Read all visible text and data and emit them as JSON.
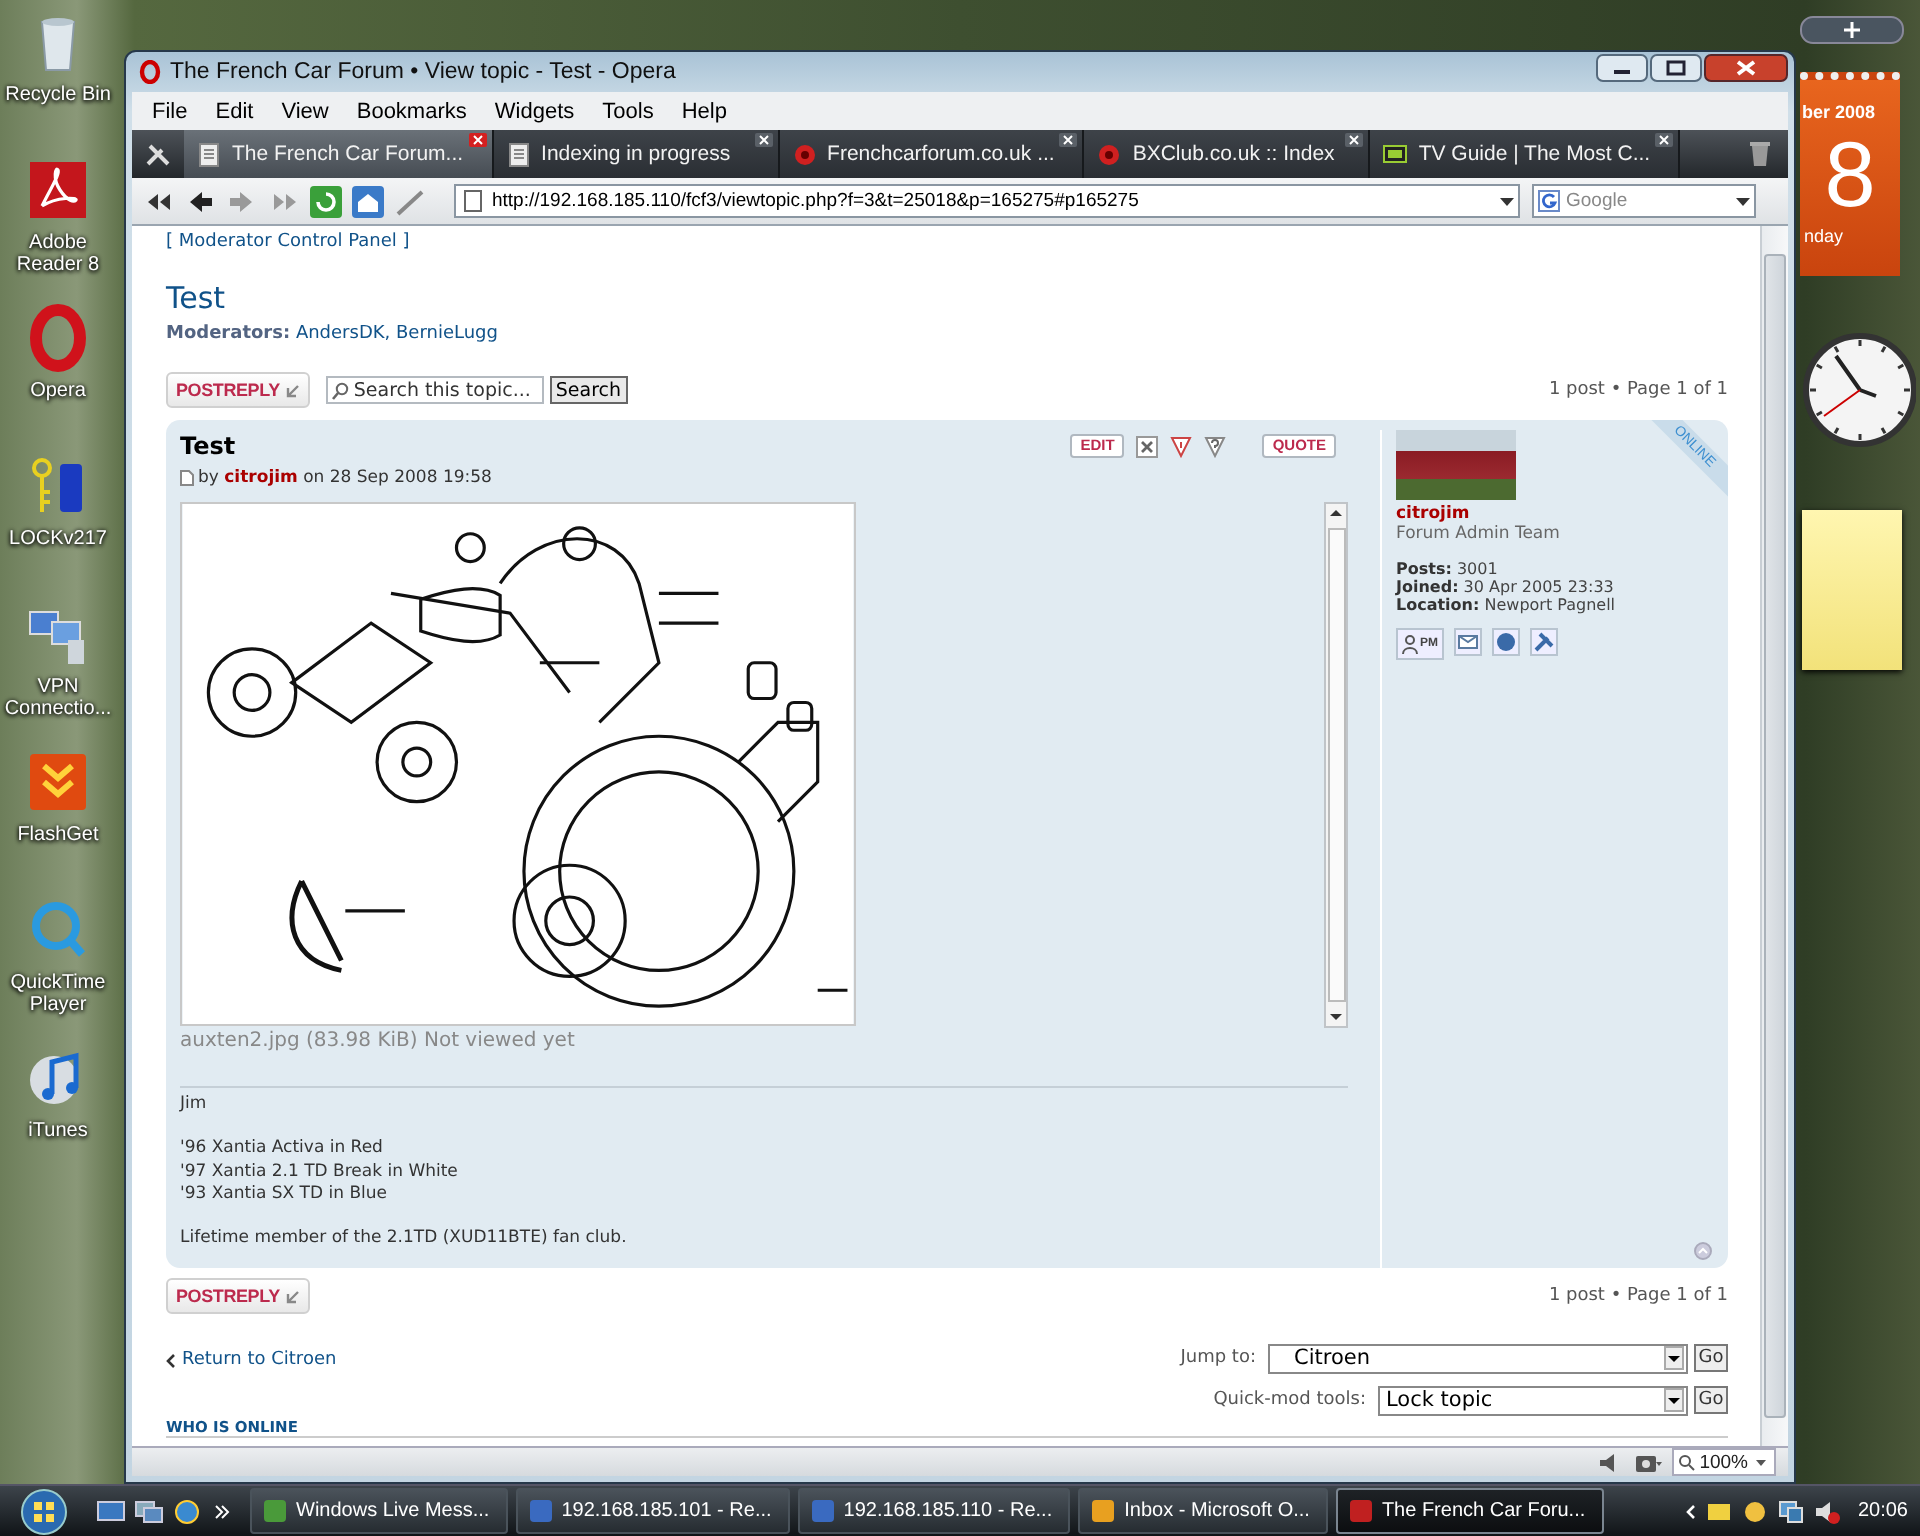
{
  "desktop_icons": [
    {
      "label": "Recycle Bin"
    },
    {
      "label": "Adobe Reader 8"
    },
    {
      "label": "Opera"
    },
    {
      "label": "LOCKv217"
    },
    {
      "label": "VPN Connectio..."
    },
    {
      "label": "FlashGet"
    },
    {
      "label": "QuickTime Player"
    },
    {
      "label": "iTunes"
    }
  ],
  "calendar": {
    "month": "ber 2008",
    "day": "8",
    "weekday": "nday"
  },
  "window": {
    "title": "The French Car Forum • View topic - Test - Opera"
  },
  "menu": [
    "File",
    "Edit",
    "View",
    "Bookmarks",
    "Widgets",
    "Tools",
    "Help"
  ],
  "tabs": [
    {
      "label": "The French Car Forum...",
      "selected": true
    },
    {
      "label": "Indexing in progress",
      "selected": false
    },
    {
      "label": "Frenchcarforum.co.uk ...",
      "selected": false
    },
    {
      "label": "BXClub.co.uk :: Index",
      "selected": false
    },
    {
      "label": "TV Guide | The Most C...",
      "selected": false
    }
  ],
  "address_bar": {
    "url": "http://192.168.185.110/fcf3/viewtopic.php?f=3&t=25018&p=165275#p165275",
    "search_placeholder": "Google"
  },
  "page": {
    "mcp_link": "[ Moderator Control Panel ]",
    "title": "Test",
    "moderators": "**Moderators:** AndersDK, BernieLugg",
    "post_reply": "POSTREPLY",
    "search_placeholder": "Search this topic...",
    "search_button": "Search",
    "pagination": "1 post • Page 1 of 1",
    "post": {
      "title": "Test",
      "byline": "by **citrojim** on 28 Sep 2008 19:58",
      "edit": "EDIT",
      "quote": "QUOTE",
      "attachment": "auxten2.jpg (83.98 KiB) Not viewed yet",
      "signature": [
        [
          "Jim"
        ],
        [
          "'96 Xantia Activa in Red",
          "'97 Xantia 2.1 TD Break in White",
          "'93 Xantia SX TD in Blue"
        ],
        [
          "Lifetime member of the 2.1TD (XUD11BTE) fan club."
        ]
      ],
      "online": "ONLINE",
      "profile": {
        "username": "citrojim",
        "rank": "Forum Admin Team",
        "fields": [
          {
            "label": "Posts:",
            "value": "3001"
          },
          {
            "label": "Joined:",
            "value": "30 Apr 2005 23:33"
          },
          {
            "label": "Location:",
            "value": "Newport Pagnell"
          }
        ],
        "pm": "PM"
      }
    },
    "bottom_post_reply": "POSTREPLY",
    "bottom_pagination": "1 post • Page 1 of 1",
    "return_link": "Return to Citroen",
    "jump_to": {
      "label": "Jump to:",
      "value": "Citroen",
      "button": "Go"
    },
    "quick_mod": {
      "label": "Quick-mod tools:",
      "value": "Lock topic",
      "button": "Go"
    },
    "who_is_online": "WHO IS ONLINE"
  },
  "status_bar": {
    "zoom": "100%"
  },
  "taskbar": {
    "items": [
      {
        "label": "Windows Live Mess...",
        "selected": false
      },
      {
        "label": "192.168.185.101 - Re...",
        "selected": false
      },
      {
        "label": "192.168.185.110 - Re...",
        "selected": false
      },
      {
        "label": "Inbox - Microsoft O...",
        "selected": false
      },
      {
        "label": "The French Car Foru...",
        "selected": true
      }
    ],
    "clock": "20:06"
  }
}
